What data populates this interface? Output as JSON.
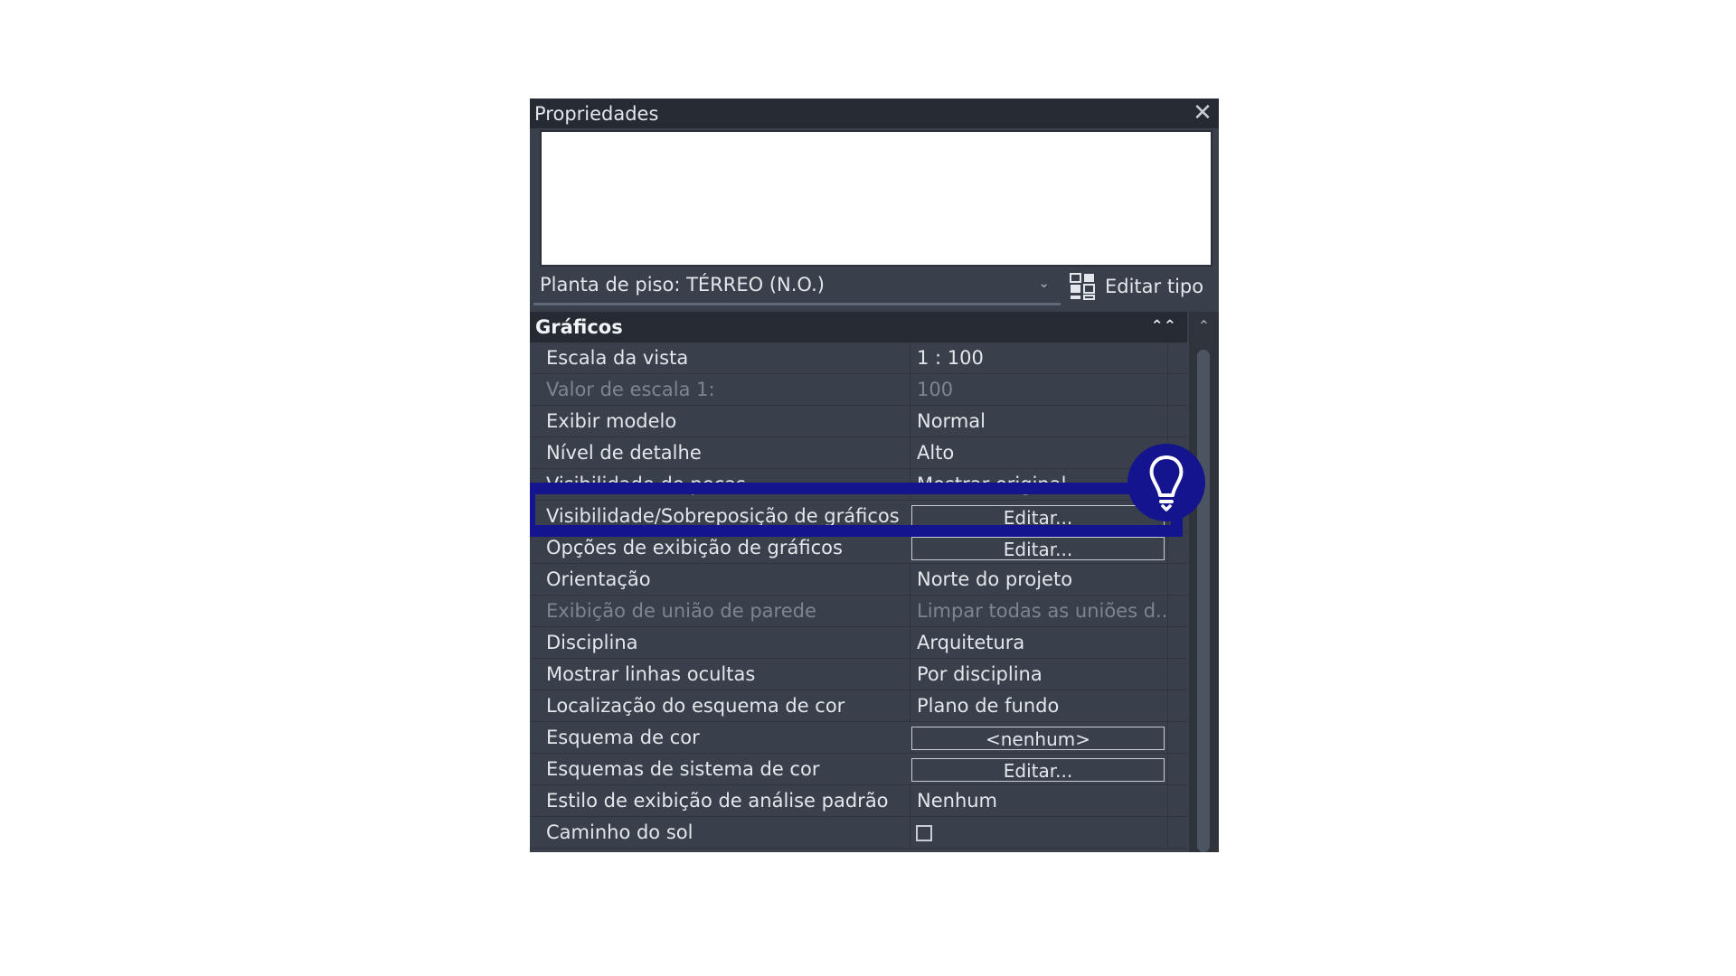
{
  "window": {
    "title": "Propriedades",
    "close_icon": "close-icon"
  },
  "type_selector": {
    "value": "Planta de piso: TÉRREO (N.O.)",
    "edit_type_label": "Editar tipo"
  },
  "section": {
    "title": "Gráficos"
  },
  "rows": [
    {
      "name": "Escala da vista",
      "value": "1 : 100",
      "kind": "text"
    },
    {
      "name": "Valor de escala    1:",
      "value": "100",
      "kind": "text",
      "disabled": true
    },
    {
      "name": "Exibir modelo",
      "value": "Normal",
      "kind": "text"
    },
    {
      "name": "Nível de detalhe",
      "value": "Alto",
      "kind": "text"
    },
    {
      "name": "Visibilidade de peças",
      "value": "Mostrar original",
      "kind": "text"
    },
    {
      "name": "Visibilidade/Sobreposição de gráficos",
      "value": "Editar...",
      "kind": "button"
    },
    {
      "name": "Opções de exibição de gráficos",
      "value": "Editar...",
      "kind": "button"
    },
    {
      "name": "Orientação",
      "value": "Norte do projeto",
      "kind": "text"
    },
    {
      "name": "Exibição de união de parede",
      "value": "Limpar todas as uniões d...",
      "kind": "text",
      "disabled": true
    },
    {
      "name": "Disciplina",
      "value": "Arquitetura",
      "kind": "text"
    },
    {
      "name": "Mostrar linhas ocultas",
      "value": "Por disciplina",
      "kind": "text"
    },
    {
      "name": "Localização do esquema de cor",
      "value": "Plano de fundo",
      "kind": "text"
    },
    {
      "name": "Esquema de cor",
      "value": "<nenhum>",
      "kind": "button"
    },
    {
      "name": "Esquemas de sistema de cor",
      "value": "Editar...",
      "kind": "button"
    },
    {
      "name": "Estilo de exibição de análise padrão",
      "value": "Nenhum",
      "kind": "text"
    },
    {
      "name": "Caminho do sol",
      "value": "",
      "kind": "checkbox",
      "checked": false
    }
  ],
  "highlight": {
    "color": "#14148f",
    "icon": "lightbulb-icon"
  },
  "colors": {
    "panel_bg": "#3a404b",
    "header_bg": "#262b33",
    "text": "#e3e6ea",
    "disabled_text": "#7e858f"
  }
}
